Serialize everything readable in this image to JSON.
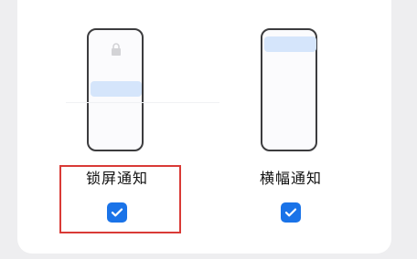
{
  "options": [
    {
      "label": "锁屏通知",
      "checked": true,
      "preview": "lock-screen",
      "icon": "lock-icon"
    },
    {
      "label": "横幅通知",
      "checked": true,
      "preview": "banner",
      "icon": "banner-notification-icon"
    }
  ],
  "colors": {
    "accent": "#1a73e8",
    "highlight_border": "#d93a36",
    "notification_preview": "#d5e5fb"
  }
}
